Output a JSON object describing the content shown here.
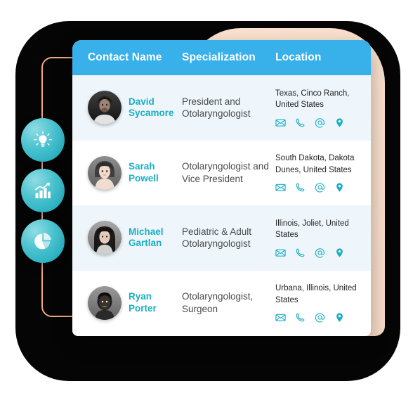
{
  "table": {
    "columns": [
      {
        "label": "Contact Name",
        "key": "name"
      },
      {
        "label": "Specialization",
        "key": "specialization"
      },
      {
        "label": "Location",
        "key": "location"
      }
    ],
    "rows": [
      {
        "name": "David Sycamore",
        "specialization": "President and Otolaryngologist",
        "location": "Texas, Cinco Ranch, United States",
        "actions": [
          "email-icon",
          "phone-icon",
          "at-icon",
          "map-pin-icon"
        ]
      },
      {
        "name": "Sarah Powell",
        "specialization": "Otolaryngologist and Vice President",
        "location": "South Dakota, Dakota Dunes, United States",
        "actions": [
          "email-icon",
          "phone-icon",
          "at-icon",
          "map-pin-icon"
        ]
      },
      {
        "name": "Michael Gartlan",
        "specialization": "Pediatric & Adult Otolaryngologist",
        "location": "Illinois, Joliet, United States",
        "actions": [
          "email-icon",
          "phone-icon",
          "at-icon",
          "map-pin-icon"
        ]
      },
      {
        "name": "Ryan Porter",
        "specialization": "Otolaryngologist, Surgeon",
        "location": "Urbana, Illinois, United States",
        "actions": [
          "email-icon",
          "phone-icon",
          "at-icon",
          "map-pin-icon"
        ]
      }
    ]
  },
  "badges": [
    {
      "icon": "lightbulb-icon"
    },
    {
      "icon": "bar-chart-growth-icon"
    },
    {
      "icon": "pie-chart-icon"
    }
  ],
  "colors": {
    "header_blue": "#38b0ea",
    "row_alt": "#eef6fc",
    "name_teal": "#1aaec2",
    "icon_teal": "#1aaec2",
    "badge_teal": "#16a6bb",
    "peach_panel": "#f8ddca",
    "backdrop_black": "#050505",
    "connector_orange": "#f0a87c"
  }
}
